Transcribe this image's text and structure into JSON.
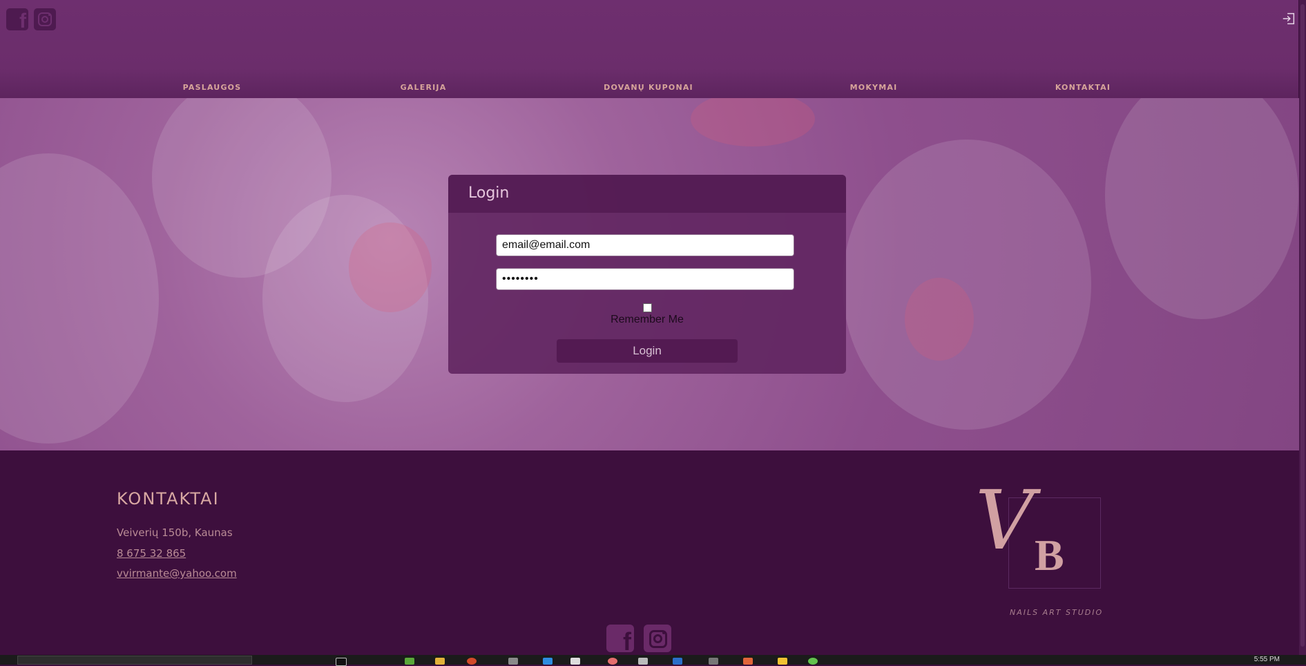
{
  "header": {
    "social_icons": [
      "facebook-icon",
      "instagram-icon"
    ],
    "login_icon": "login-icon"
  },
  "nav": {
    "items": [
      {
        "label": "PASLAUGOS"
      },
      {
        "label": "GALERIJA"
      },
      {
        "label": "DOVANŲ KUPONAI"
      },
      {
        "label": "MOKYMAI"
      },
      {
        "label": "KONTAKTAI"
      }
    ]
  },
  "login_form": {
    "title": "Login",
    "email_value": "email@email.com",
    "password_value": "••••••••",
    "remember_label": "Remember Me",
    "remember_checked": false,
    "submit_label": "Login"
  },
  "footer": {
    "title": "KONTAKTAI",
    "address": "Veiverių 150b, Kaunas",
    "phone": "8 675 32 865",
    "email": "vvirmante@yahoo.com",
    "logo": {
      "letter_v": "V",
      "letter_b": "B",
      "subtitle": "NAILS ART STUDIO"
    },
    "social_icons": [
      "facebook-icon",
      "instagram-icon"
    ]
  },
  "taskbar": {
    "clock": "5:55 PM"
  },
  "colors": {
    "header": "#6e2f6f",
    "footer": "#3d0f3d",
    "button": "#531a52",
    "accent_text": "#d7a59a"
  }
}
